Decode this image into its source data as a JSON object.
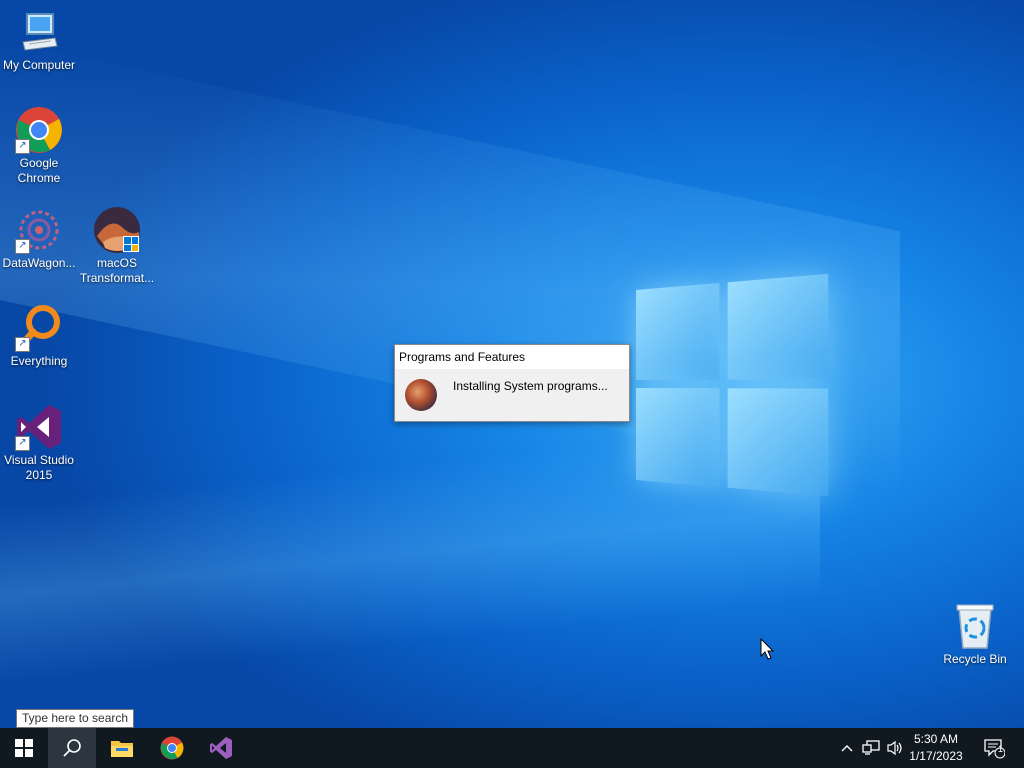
{
  "desktop": {
    "icons": [
      {
        "label": "My Computer",
        "icon": "computer-icon"
      },
      {
        "label": "Google Chrome",
        "icon": "chrome-icon"
      },
      {
        "label": "DataWagon...",
        "icon": "datawagon-icon"
      },
      {
        "label": "macOS Transformat...",
        "icon": "macos-transformation-icon"
      },
      {
        "label": "Everything",
        "icon": "everything-search-icon"
      },
      {
        "label": "Visual Studio 2015",
        "icon": "visual-studio-icon"
      },
      {
        "label": "Recycle Bin",
        "icon": "recycle-bin-icon"
      }
    ]
  },
  "dialog": {
    "title": "Programs and Features",
    "message": "Installing System programs..."
  },
  "search": {
    "placeholder": "Type here to search"
  },
  "taskbar": {
    "pinned": [
      "start-icon",
      "search-icon",
      "file-explorer-icon",
      "chrome-icon",
      "visual-studio-icon"
    ],
    "clock": {
      "time": "5:30 AM",
      "date": "1/17/2023"
    },
    "notification_count": "1"
  },
  "colors": {
    "accent": "#0a62c9",
    "taskbar": "#101820"
  }
}
